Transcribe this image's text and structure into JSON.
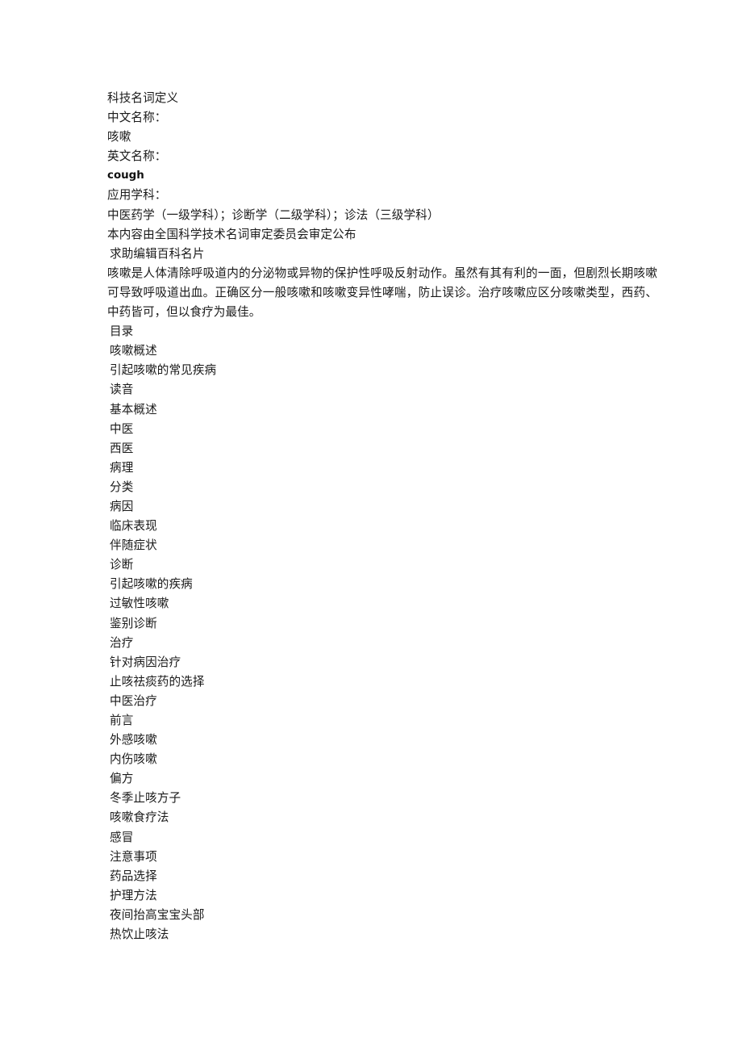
{
  "document": {
    "term_definition_heading": "科技名词定义",
    "fields": [
      {
        "label": "中文名称：",
        "value": "咳嗽",
        "value_is_latin": false
      },
      {
        "label": "英文名称：",
        "value": "cough",
        "value_is_latin": true
      },
      {
        "label": "应用学科：",
        "value": "中医药学（一级学科）；诊断学（二级学科）；诊法（三级学科）",
        "value_is_latin": false
      }
    ],
    "field_label_cn": "中文名称：",
    "field_value_cn": "咳嗽",
    "field_label_en": "英文名称：",
    "field_value_en": "cough",
    "field_label_subject": "应用学科：",
    "field_value_subject": "中医药学（一级学科）；诊断学（二级学科）；诊法（三级学科）",
    "approval_notice": "本内容由全国科学技术名词审定委员会审定公布",
    "edit_card_link": "求助编辑百科名片",
    "intro_paragraph": "咳嗽是人体清除呼吸道内的分泌物或异物的保护性呼吸反射动作。虽然有其有利的一面，但剧烈长期咳嗽可导致呼吸道出血。正确区分一般咳嗽和咳嗽变异性哮喘，防止误诊。治疗咳嗽应区分咳嗽类型，西药、中药皆可，但以食疗为最佳。"
  },
  "toc": {
    "heading": "目录",
    "items": [
      "咳嗽概述",
      "引起咳嗽的常见疾病",
      "读音",
      "基本概述",
      "中医",
      "西医",
      "病理",
      "分类",
      "病因",
      "临床表现",
      "伴随症状",
      "诊断",
      "引起咳嗽的疾病",
      "过敏性咳嗽",
      "鉴别诊断",
      "治疗",
      "针对病因治疗",
      "止咳祛痰药的选择",
      "中医治疗",
      "前言",
      "外感咳嗽",
      "内伤咳嗽",
      "偏方",
      "冬季止咳方子",
      "咳嗽食疗法",
      "感冒",
      "注意事项",
      "药品选择",
      "护理方法",
      "夜间抬高宝宝头部",
      "热饮止咳法"
    ]
  },
  "colors": {
    "background": "#ffffff",
    "text": "#1a1a1a"
  }
}
